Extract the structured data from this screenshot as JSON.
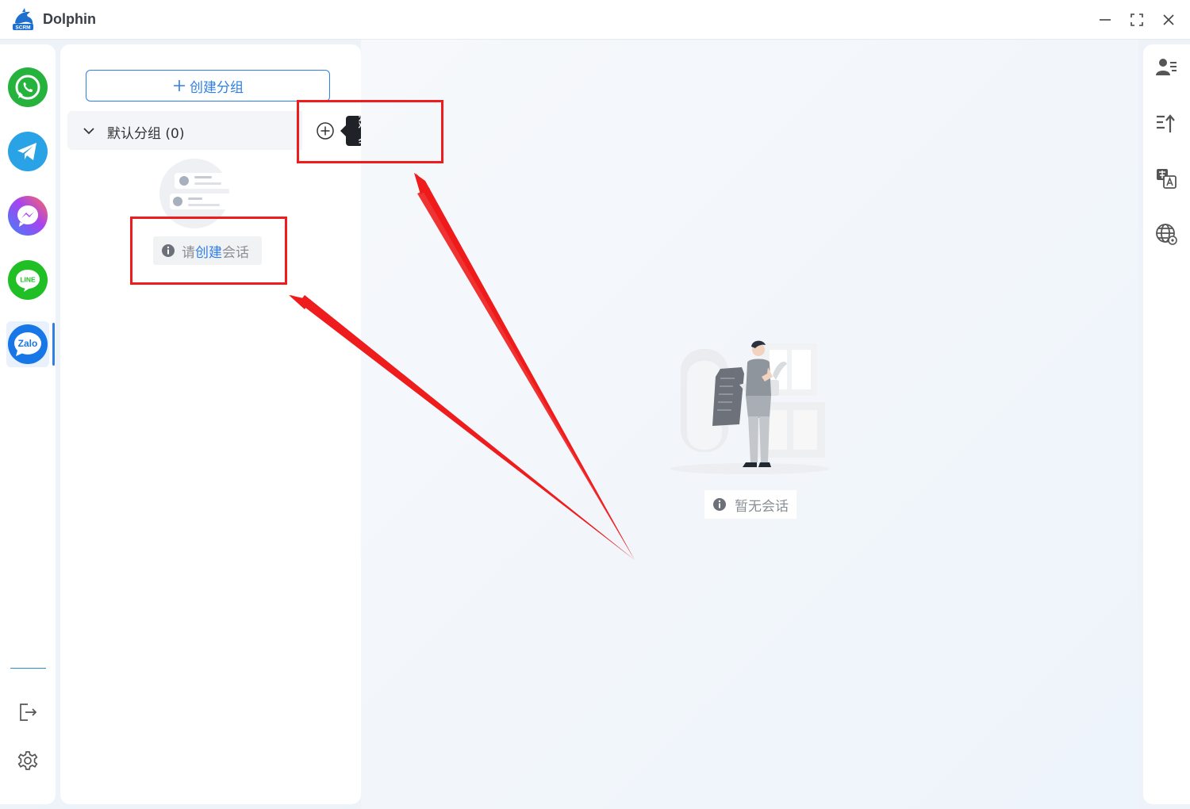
{
  "window": {
    "title": "Dolphin",
    "logo_text": "SCRM",
    "controls": [
      "minimize-icon",
      "maximize-icon",
      "close-icon"
    ]
  },
  "platforms": [
    {
      "name": "WhatsApp",
      "icon": "whatsapp-icon",
      "color": "#25b33e",
      "active": false
    },
    {
      "name": "Telegram",
      "icon": "telegram-icon",
      "color": "#2aa3e6",
      "active": false
    },
    {
      "name": "Messenger",
      "icon": "messenger-icon",
      "color": "#a544f0",
      "active": false
    },
    {
      "name": "LINE",
      "icon": "line-icon",
      "color": "#1fbf25",
      "active": false,
      "label": "LINE"
    },
    {
      "name": "Zalo",
      "icon": "zalo-icon",
      "color": "#1877e6",
      "active": true,
      "label": "Zalo"
    }
  ],
  "rail_bottom": {
    "logout_icon": "logout-icon",
    "settings_icon": "gear-icon"
  },
  "group_panel": {
    "create_group_label": "创建分组",
    "group": {
      "label": "默认分组 (0)",
      "expanded": true
    },
    "add_session_tooltip": "创建会话",
    "empty_hint": {
      "prefix": "请",
      "link": "创建",
      "suffix": "会话"
    }
  },
  "main": {
    "empty_text": "暂无会话"
  },
  "right_toolbar": [
    "contact-list-icon",
    "sort-upload-icon",
    "translate-icon",
    "globe-settings-icon"
  ],
  "colors": {
    "accent": "#2f7fe6",
    "highlight": "#ee1c1c",
    "tooltip_bg": "#1f2328"
  }
}
